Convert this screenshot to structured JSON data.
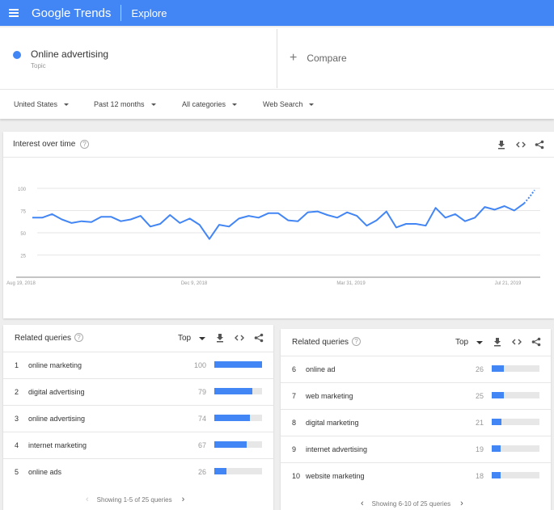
{
  "header": {
    "logo": "Google Trends",
    "section": "Explore"
  },
  "search": {
    "term": {
      "name": "Online advertising",
      "type": "Topic",
      "color": "#4285f4"
    },
    "compare_label": "Compare"
  },
  "filters": [
    "United States",
    "Past 12 months",
    "All categories",
    "Web Search"
  ],
  "interest": {
    "title": "Interest over time",
    "y_ticks": [
      "100",
      "75",
      "50",
      "25"
    ],
    "x_labels": [
      "Aug 19, 2018",
      "Dec 9, 2018",
      "Mar 31, 2019",
      "Jul 21, 2019"
    ]
  },
  "chart_data": {
    "type": "line",
    "title": "Interest over time",
    "xlabel": "",
    "ylabel": "",
    "ylim": [
      0,
      100
    ],
    "y_ticks": [
      100,
      75,
      50,
      25
    ],
    "x_tick_labels": [
      "Aug 19, 2018",
      "Dec 9, 2018",
      "Mar 31, 2019",
      "Jul 21, 2019"
    ],
    "grid": true,
    "series": [
      {
        "values": [
          67,
          67,
          71,
          65,
          61,
          63,
          62,
          68,
          68,
          63,
          65,
          69,
          57,
          60,
          70,
          61,
          66,
          59,
          43,
          59,
          57,
          66,
          69,
          67,
          72,
          72,
          64,
          63,
          73,
          74,
          70,
          67,
          73,
          69,
          58,
          64,
          74,
          56,
          60,
          60,
          58,
          78,
          67,
          71,
          63,
          67,
          79,
          76,
          80,
          75,
          83
        ],
        "partial_values": [
          83,
          90,
          98
        ]
      }
    ]
  },
  "related1": {
    "title": "Related queries",
    "mode": "Top",
    "rows": [
      {
        "rank": "1",
        "query": "online marketing",
        "value": "100"
      },
      {
        "rank": "2",
        "query": "digital advertising",
        "value": "79"
      },
      {
        "rank": "3",
        "query": "online advertising",
        "value": "74"
      },
      {
        "rank": "4",
        "query": "internet marketing",
        "value": "67"
      },
      {
        "rank": "5",
        "query": "online ads",
        "value": "26"
      }
    ],
    "pager": "Showing 1-5 of 25 queries"
  },
  "related2": {
    "title": "Related queries",
    "mode": "Top",
    "rows": [
      {
        "rank": "6",
        "query": "online ad",
        "value": "26"
      },
      {
        "rank": "7",
        "query": "web marketing",
        "value": "25"
      },
      {
        "rank": "8",
        "query": "digital marketing",
        "value": "21"
      },
      {
        "rank": "9",
        "query": "internet advertising",
        "value": "19"
      },
      {
        "rank": "10",
        "query": "website marketing",
        "value": "18"
      }
    ],
    "pager": "Showing 6-10 of 25 queries"
  }
}
